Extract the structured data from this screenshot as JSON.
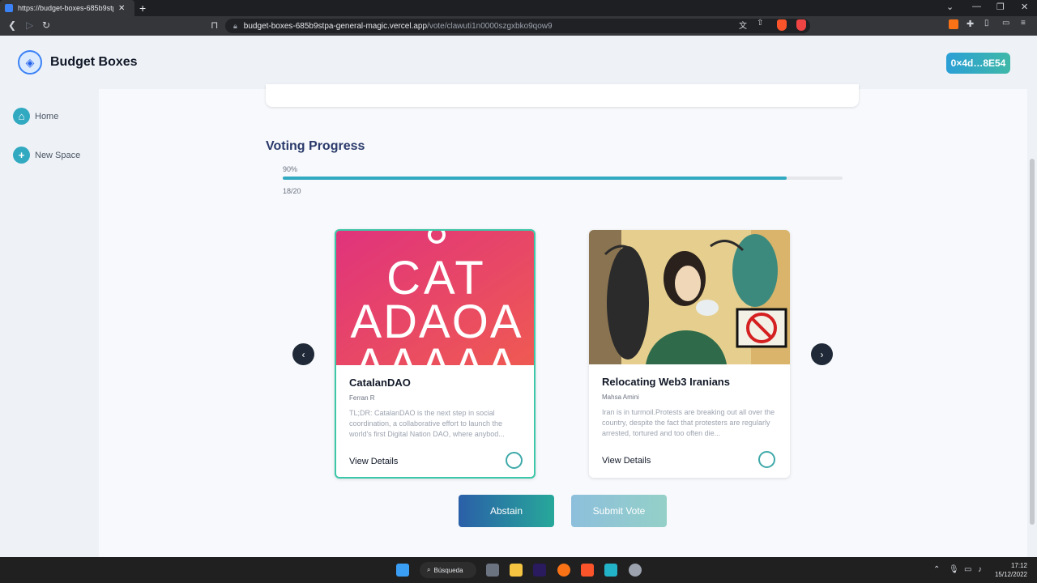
{
  "browser": {
    "tab_title": "https://budget-boxes-685b9stpa",
    "url_host": "budget-boxes-685b9stpa-general-magic.vercel.app",
    "url_path": "/vote/clawuti1n0000szgxbko9qow9"
  },
  "header": {
    "brand": "Budget Boxes",
    "wallet": "0×4d…8E54"
  },
  "sidebar": {
    "items": [
      {
        "label": "Home",
        "icon": "home-icon"
      },
      {
        "label": "New Space",
        "icon": "plus-icon"
      }
    ]
  },
  "voting": {
    "title": "Voting Progress",
    "percent_label": "90%",
    "progress": 0.9,
    "count_label": "18/20"
  },
  "cards": [
    {
      "name": "CatalanDAO",
      "author": "Ferran R",
      "description": "TL;DR: CatalanDAO is the next step in social coordination, a collaborative effort to launch the world's first Digital Nation DAO, where anybod...",
      "link": "View Details",
      "selected": true,
      "image_text": [
        "CAT",
        "ADAOA",
        "AAAAA"
      ]
    },
    {
      "name": "Relocating Web3 Iranians",
      "author": "Mahsa Amini",
      "description": "Iran is in turmoil.Protests are breaking out all over the country, despite the fact that protesters are regularly arrested, tortured and too often die...",
      "link": "View Details",
      "selected": false
    }
  ],
  "actions": {
    "abstain": "Abstain",
    "submit": "Submit Vote"
  },
  "taskbar": {
    "search": "Búsqueda",
    "time": "17:12",
    "date": "15/12/2022"
  },
  "colors": {
    "accent": "#31a9c0",
    "selected_border": "#3cc7a8",
    "title": "#2b3a6b"
  }
}
